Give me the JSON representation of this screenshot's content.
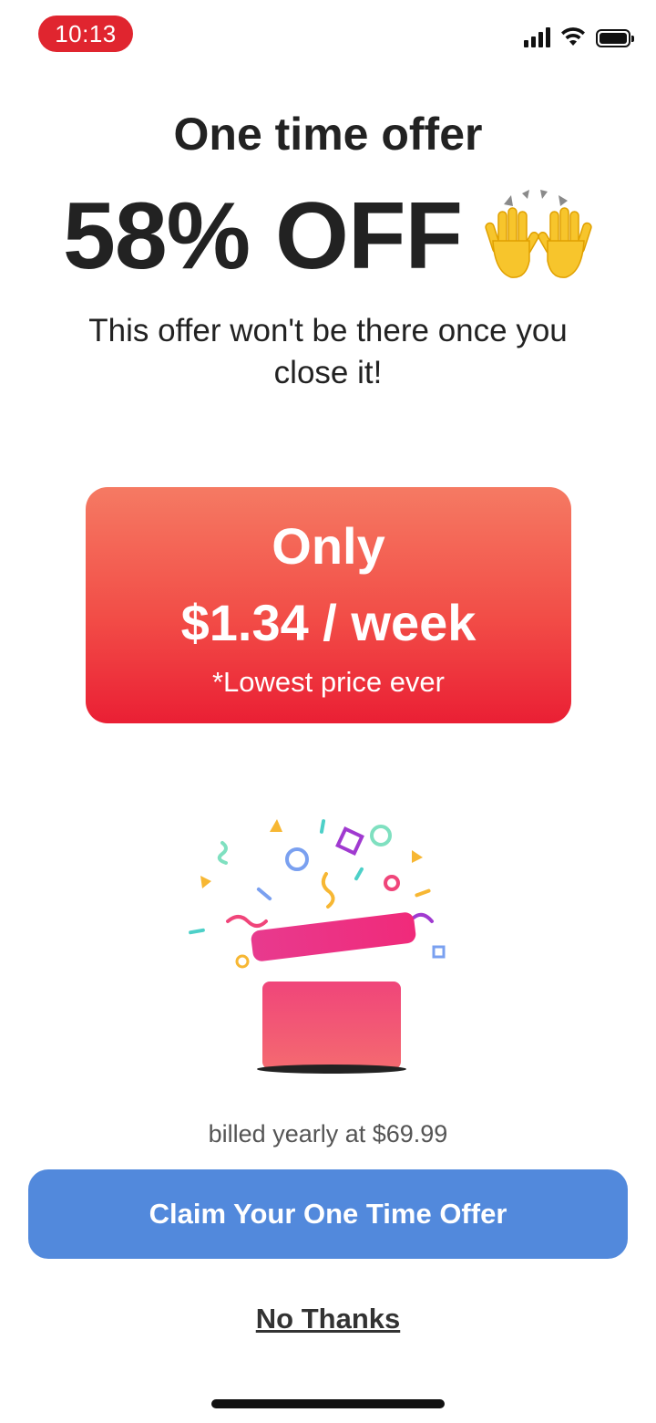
{
  "status_bar": {
    "time": "10:13",
    "time_pill_color": "#e0252f",
    "icons": [
      "cellular-signal-icon",
      "wifi-icon",
      "battery-icon"
    ]
  },
  "header": {
    "title": "One time offer",
    "discount": "58% OFF",
    "emoji_icon": "raising-hands-icon",
    "subtitle": "This offer won't be there once you close it!"
  },
  "price_card": {
    "line1": "Only",
    "line2": "$1.34 / week",
    "note": "*Lowest price ever",
    "gradient_top": "#f57a63",
    "gradient_bottom": "#ea1f34"
  },
  "illustration": {
    "icon": "gift-box-confetti-icon"
  },
  "billing": {
    "text": "billed yearly at $69.99"
  },
  "actions": {
    "claim_label": "Claim Your One Time Offer",
    "claim_color": "#5289dc",
    "dismiss_label": "No Thanks"
  }
}
